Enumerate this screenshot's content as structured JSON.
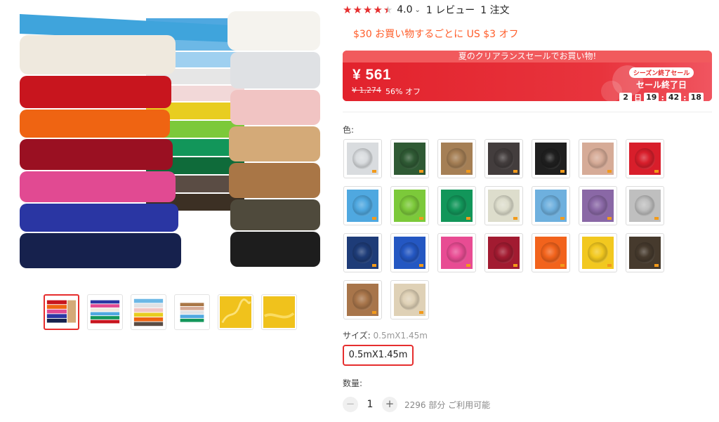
{
  "rating": {
    "value": "4.0",
    "stars_filled": 4,
    "stars_total": 5,
    "reviews": "1 レビュー",
    "orders": "1 注文"
  },
  "coupon": "$30 お買い物するごとに US $3 オフ",
  "sale": {
    "banner_title": "夏のクリアランスセールでお買い物!",
    "price": "¥ 561",
    "original_price": "¥ 1,274",
    "discount": "56% オフ",
    "season_tag": "シーズン終了セール",
    "ends_label": "セール終了日",
    "countdown": {
      "days": "2",
      "days_unit": "日",
      "hours": "19",
      "minutes": "42",
      "seconds": "18"
    }
  },
  "colors": {
    "label": "色:",
    "swatches": [
      "#d9dcdf",
      "#2f5a34",
      "#a57f55",
      "#433d3d",
      "#1f1f1f",
      "#d6ab97",
      "#d81e2b",
      "#4fa8e0",
      "#7cc93a",
      "#12965a",
      "#ddddcc",
      "#6eb0de",
      "#8a68a6",
      "#bfbfbf",
      "#1e3c78",
      "#2457c2",
      "#e84c93",
      "#a21b31",
      "#f2631c",
      "#f2c81f",
      "#463a2d",
      "#a8754a",
      "#dfd1b6"
    ]
  },
  "size": {
    "label": "サイズ:",
    "selected_value": "0.5mX1.45m",
    "option": "0.5mX1.45m"
  },
  "quantity": {
    "label": "数量:",
    "value": "1",
    "minus": "−",
    "plus": "+",
    "available": "2296 部分 ご利用可能"
  },
  "accent_color": "#e62e2e"
}
